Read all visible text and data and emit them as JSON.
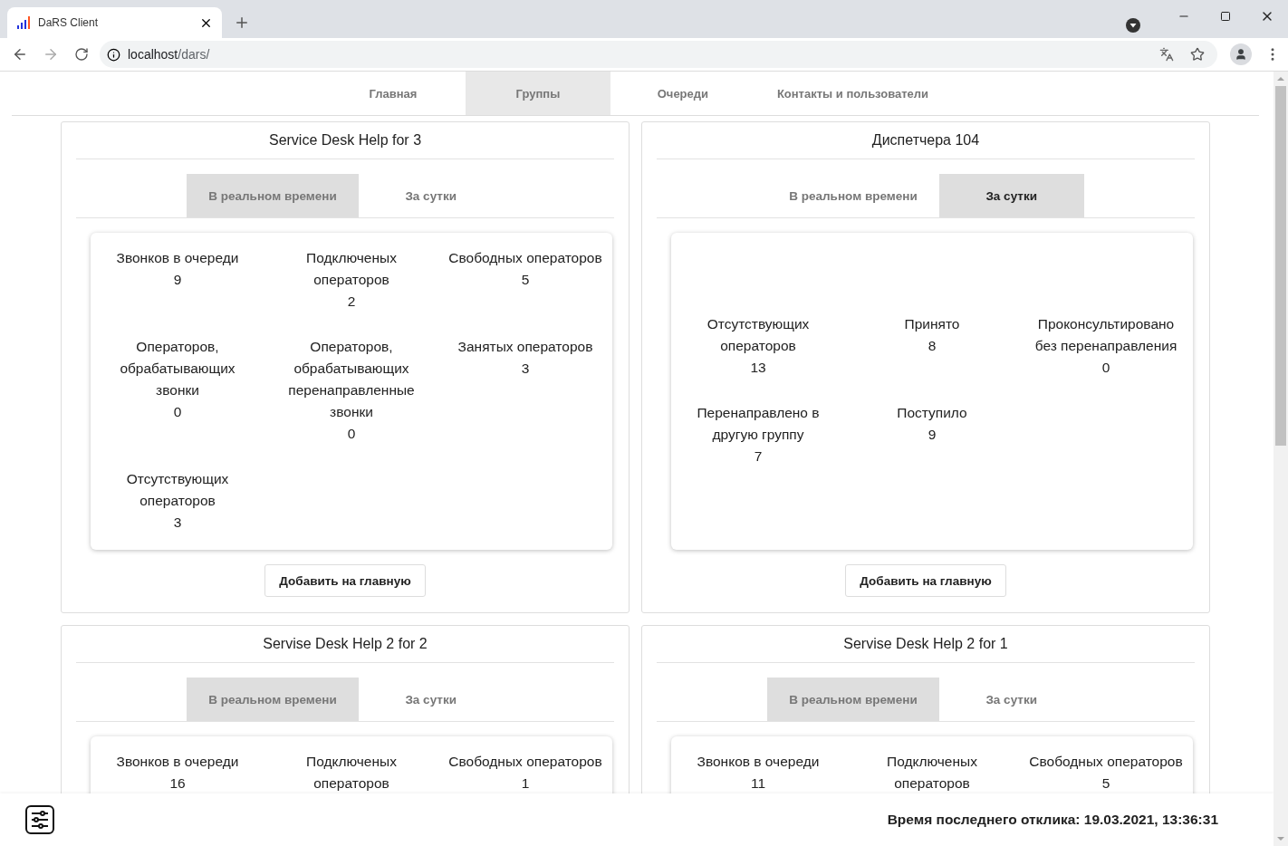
{
  "browser": {
    "tab_title": "DaRS Client",
    "url_host": "localhost",
    "url_path": "/dars/"
  },
  "nav": [
    {
      "label": "Главная",
      "selected": false
    },
    {
      "label": "Группы",
      "selected": true
    },
    {
      "label": "Очереди",
      "selected": false
    },
    {
      "label": "Контакты и пользователи",
      "selected": false
    }
  ],
  "groups": [
    {
      "title": "Service Desk Help for 3",
      "tabs": [
        {
          "label": "В реальном времени",
          "selected": true
        },
        {
          "label": "За сутки",
          "selected": false
        }
      ],
      "stats": [
        {
          "label": "Звонков в очереди",
          "value": "9"
        },
        {
          "label": "Подключеных операторов",
          "value": "2"
        },
        {
          "label": "Свободных операторов",
          "value": "5"
        },
        {
          "label": "Операторов, обрабатывающих звонки",
          "value": "0"
        },
        {
          "label": "Операторов, обрабатывающих перенаправленные звонки",
          "value": "0"
        },
        {
          "label": "Занятых операторов",
          "value": "3"
        },
        {
          "label": "Отсутствующих операторов",
          "value": "3"
        }
      ],
      "button": "Добавить на главную"
    },
    {
      "title": "Диспетчера 104",
      "tabs": [
        {
          "label": "В реальном времени",
          "selected": false
        },
        {
          "label": "За сутки",
          "selected": true
        }
      ],
      "stats": [
        {
          "label": "Отсутствующих операторов",
          "value": "13"
        },
        {
          "label": "Принято",
          "value": "8"
        },
        {
          "label": "Проконсультировано без перенаправления",
          "value": "0"
        },
        {
          "label": "Перенаправлено в другую группу",
          "value": "7"
        },
        {
          "label": "Поступило",
          "value": "9"
        }
      ],
      "button": "Добавить на главную"
    },
    {
      "title": "Servise Desk Help 2 for 2",
      "tabs": [
        {
          "label": "В реальном времени",
          "selected": true
        },
        {
          "label": "За сутки",
          "selected": false
        }
      ],
      "stats": [
        {
          "label": "Звонков в очереди",
          "value": "16"
        },
        {
          "label": "Подключеных операторов"
        },
        {
          "label": "Свободных операторов",
          "value": "1"
        }
      ]
    },
    {
      "title": "Servise Desk Help 2 for 1",
      "tabs": [
        {
          "label": "В реальном времени",
          "selected": true
        },
        {
          "label": "За сутки",
          "selected": false
        }
      ],
      "stats": [
        {
          "label": "Звонков в очереди",
          "value": "11"
        },
        {
          "label": "Подключеных операторов"
        },
        {
          "label": "Свободных операторов",
          "value": "5"
        }
      ]
    }
  ],
  "footer": {
    "last_response": "Время последнего отклика: 19.03.2021, 13:36:31"
  }
}
